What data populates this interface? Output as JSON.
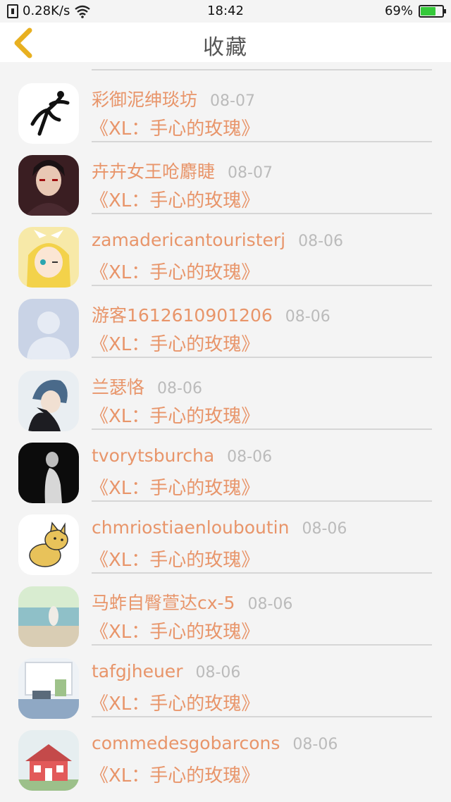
{
  "status": {
    "speed": "0.28K/s",
    "time": "18:42",
    "battery": "69%",
    "battery_level": 0.69
  },
  "header": {
    "title": "收藏"
  },
  "items": [
    {
      "name": "彩御泥绅琰坊",
      "date": "08-07",
      "book": "《XL：手心的玫瑰》",
      "avatar": "dancer-avatar"
    },
    {
      "name": "卉卉女王呛麝睫",
      "date": "08-07",
      "book": "《XL：手心的玫瑰》",
      "avatar": "anime-ninja-avatar"
    },
    {
      "name": "zamadericantouristerj",
      "date": "08-06",
      "book": "《XL：手心的玫瑰》",
      "avatar": "anime-girl-avatar"
    },
    {
      "name": "游客1612610901206",
      "date": "08-06",
      "book": "《XL：手心的玫瑰》",
      "avatar": "default-user-avatar"
    },
    {
      "name": "兰瑟恪",
      "date": "08-06",
      "book": "《XL：手心的玫瑰》",
      "avatar": "anime-boy-cat-avatar"
    },
    {
      "name": "tvorytsburcha",
      "date": "08-06",
      "book": "《XL：手心的玫瑰》",
      "avatar": "dark-portrait-avatar"
    },
    {
      "name": "chmriostiaenlouboutin",
      "date": "08-06",
      "book": "《XL：手心的玫瑰》",
      "avatar": "doge-avatar"
    },
    {
      "name": "马蚱自臀萱达cx-5",
      "date": "08-06",
      "book": "《XL：手心的玫瑰》",
      "avatar": "beach-avatar"
    },
    {
      "name": "tafgjheuer",
      "date": "08-06",
      "book": "《XL：手心的玫瑰》",
      "avatar": "window-scene-avatar"
    },
    {
      "name": "commedesgobarcons",
      "date": "08-06",
      "book": "《XL：手心的玫瑰》",
      "avatar": "red-house-avatar"
    }
  ]
}
